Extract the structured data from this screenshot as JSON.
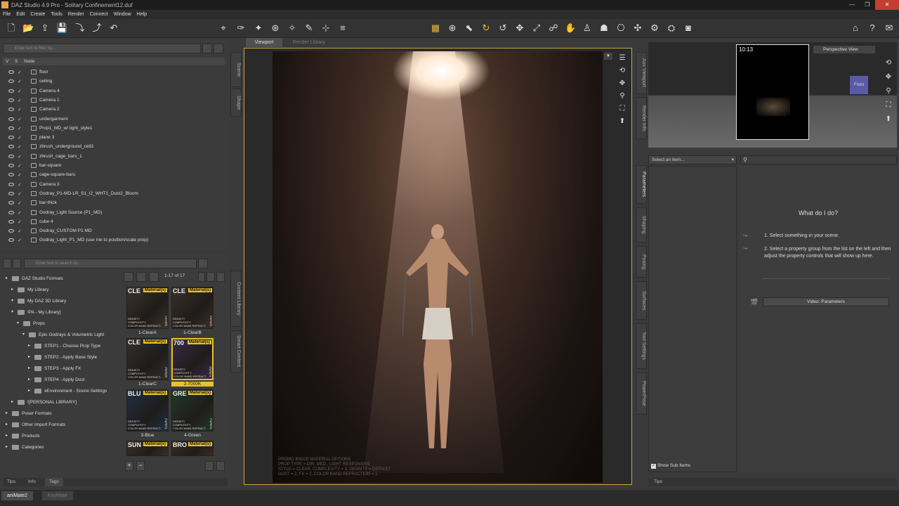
{
  "title": "DAZ Studio 4.9 Pro - Solitary Confinement12.duf",
  "window_controls": [
    "—",
    "❐",
    "✕"
  ],
  "menu": [
    "File",
    "Edit",
    "Create",
    "Tools",
    "Render",
    "Connect",
    "Window",
    "Help"
  ],
  "scene": {
    "filter_placeholder": "Enter text to filter by...",
    "col_v": "V",
    "col_s": "S",
    "col_node": "Node",
    "nodes": [
      "floor",
      "ceiling",
      "Camera 4",
      "Camera 1",
      "Camera 2",
      "undergarment",
      "Prop1_MD_w/ light_style1",
      "plane 3",
      "zbrush_underground_cell3",
      "zbrush_cage_bars_1",
      "bar-square",
      "cage-square-bars",
      "Camera 3",
      "Godray_P1-MD-LR_S1_I2_WHT1_Dust2_Bloom",
      "bar-thick",
      "Godray_Light Source (P1_MD)",
      "cube 4",
      "Godray_CUSTOM P1 MD",
      "Godray_Light_P1_MD (use me to position/scale prop)"
    ]
  },
  "side_tabs_left": [
    "Scene",
    "Shape"
  ],
  "side_tabs_left2": [
    "Content Library",
    "Smart Content"
  ],
  "library": {
    "search_placeholder": "Enter text to search by...",
    "page_info": "1-17 of 17",
    "tree": [
      "DAZ Studio Formats",
      "My Library",
      "My DAZ 3D Library",
      "!PA - My Library]",
      "Props",
      "Epic Godrays & Volumetric Light",
      "STEP1 - Choose Prop Type",
      "STEP2 - Apply Base Style",
      "STEP3 - Apply FX",
      "STEP4 - Apply Dust",
      "xEnvironment - Scene Settings",
      "![PERSONAL LIBRARY]",
      "Poser Formats",
      "Other Import Formats",
      "Products",
      "Categories"
    ],
    "thumbs": [
      {
        "code": "CLE",
        "badge": "Material(s)",
        "label": "1-ClearA",
        "density": "DENSITY",
        "complexity": "COMPLEXITY",
        "refract": "COLOR BAND REFRACT.",
        "d": "1",
        "c": "1",
        "r": "0"
      },
      {
        "code": "CLE",
        "badge": "Material(s)",
        "label": "1-ClearB",
        "density": "DENSITY",
        "complexity": "COMPLEXITY",
        "refract": "COLOR BAND REFRACT.",
        "d": "2",
        "c": "2",
        "r": "0"
      },
      {
        "code": "CLE",
        "badge": "Material(s)",
        "label": "1-ClearC",
        "density": "DENSITY",
        "complexity": "COMPLEXITY",
        "refract": "COLOR BAND REFRACT.",
        "d": "3",
        "c": "3",
        "r": "0"
      },
      {
        "code": "700",
        "badge": "Material(s)",
        "label": "2-7000K",
        "density": "DENSITY",
        "complexity": "COMPLEXITY",
        "refract": "COLOR BAND REFRACT.",
        "d": "3",
        "c": "3",
        "r": "2"
      },
      {
        "code": "BLU",
        "badge": "Material(s)",
        "label": "3-Blue",
        "density": "DENSITY",
        "complexity": "COMPLEXITY",
        "refract": "COLOR BAND REFRACT.",
        "d": "2",
        "c": "3",
        "r": "2"
      },
      {
        "code": "GRE",
        "badge": "Material(s)",
        "label": "4-Green",
        "density": "DENSITY",
        "complexity": "COMPLEXITY",
        "refract": "COLOR BAND REFRACT.",
        "d": "2",
        "c": "3",
        "r": "2"
      },
      {
        "code": "SUN",
        "badge": "Material(s)",
        "label": "",
        "density": "",
        "complexity": "",
        "refract": "",
        "d": "",
        "c": "",
        "r": ""
      },
      {
        "code": "BRO",
        "badge": "Material(s)",
        "label": "",
        "density": "",
        "complexity": "",
        "refract": "",
        "d": "",
        "c": "",
        "r": ""
      }
    ]
  },
  "left_bottom_tabs": [
    "Tips",
    "Info",
    "Tags"
  ],
  "viewport": {
    "tab_active": "Viewport",
    "tab_inactive": "Render Library",
    "promo_line1": "PROMO IMAGE MATERIAL OPTIONS",
    "promo_line2": "PROP TYPE = DIR, MED., LIGHT RESPONSIVE",
    "promo_line3": "STYLE = CLEAR, COMPLEXITY = 3, DENSITY = DEFAULT",
    "promo_line4": "DUST = 2, FX = 2, COLOR BAND REFRACTION = 1"
  },
  "aux": {
    "time": "10:13",
    "view_select": "Perspective View",
    "cube_label": "Front"
  },
  "side_tabs_right": [
    "Aux Viewport",
    "Render Info"
  ],
  "side_tabs_right2": [
    "Parameters",
    "Shaping",
    "Posing",
    "Surfaces",
    "Tool Settings",
    "PowerPose"
  ],
  "params": {
    "select_placeholder": "Select an item...",
    "help_title": "What do I do?",
    "step1": "1. Select something in your scene.",
    "step2": "2. Select a property group from the list on the left and then adjust the property controls that will show up here.",
    "video_button": "Video: Parameters",
    "show_sub_items": "Show Sub Items",
    "tips_tab": "Tips"
  },
  "status_tabs": [
    "aniMate2",
    "KeyMate"
  ],
  "colors": {
    "accent": "#e6b73a",
    "close": "#c43d32",
    "viewport_border": "#c9a63a"
  }
}
